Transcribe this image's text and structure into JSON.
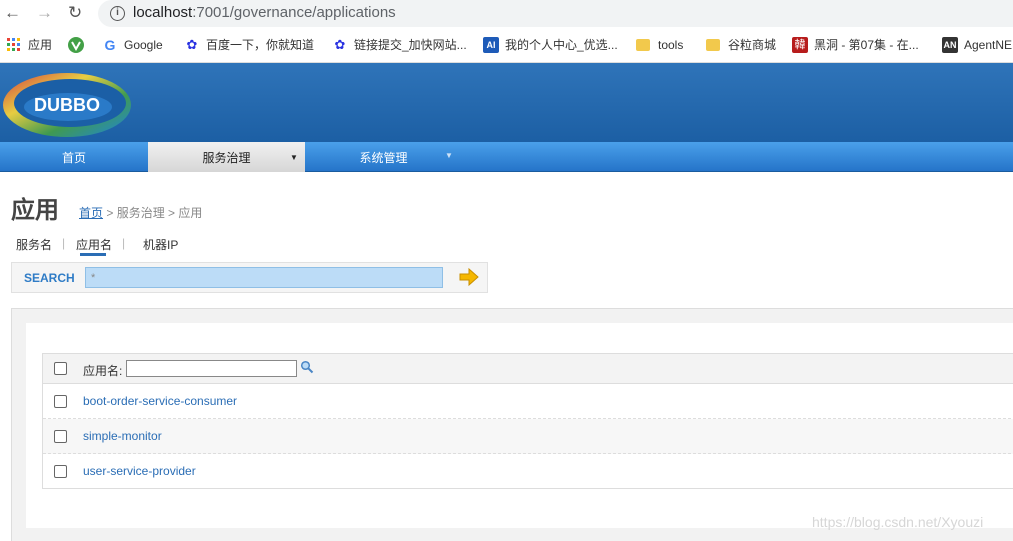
{
  "browser": {
    "url_host": "localhost",
    "url_path": ":7001/governance/applications"
  },
  "bookmarks": [
    {
      "label": "应用",
      "icon": "apps-grid-icon",
      "color": "#e94335"
    },
    {
      "label": "",
      "icon": "green-v-icon",
      "color": "#4caf50"
    },
    {
      "label": "Google",
      "icon": "google-g-icon",
      "color": "#4285f4"
    },
    {
      "label": "百度一下，你就知道",
      "icon": "baidu-paw-icon",
      "color": "#2932e1"
    },
    {
      "label": "链接提交_加快网站...",
      "icon": "baidu-paw-icon",
      "color": "#2932e1"
    },
    {
      "label": "我的个人中心_优选...",
      "icon": "ai-icon",
      "color": "#1e5bb8"
    },
    {
      "label": "tools",
      "icon": "folder-icon",
      "color": "#f2c94c"
    },
    {
      "label": "谷粒商城",
      "icon": "folder-icon",
      "color": "#f2c94c"
    },
    {
      "label": "黑洞 - 第07集 - 在...",
      "icon": "korean-icon",
      "color": "#b71c1c"
    },
    {
      "label": "AgentNE",
      "icon": "an-icon",
      "color": "#333333"
    }
  ],
  "nav": {
    "home": "首页",
    "service_gov": "服务治理",
    "system_mgmt": "系统管理"
  },
  "page": {
    "title": "应用",
    "breadcrumb_home": "首页",
    "breadcrumb_rest": " > 服务治理 > 应用"
  },
  "tabs": {
    "service_name": "服务名",
    "app_name": "应用名",
    "machine_ip": "机器IP"
  },
  "search": {
    "label": "SEARCH",
    "value": "*"
  },
  "table": {
    "header_label": "应用名:",
    "rows": [
      "boot-order-service-consumer",
      "simple-monitor",
      "user-service-provider"
    ]
  },
  "watermark": "https://blog.csdn.net/Xyouzi",
  "colors": {
    "header_blue": "#1f63a8",
    "nav_blue": "#2f86d6",
    "link_blue": "#2a6db5"
  }
}
